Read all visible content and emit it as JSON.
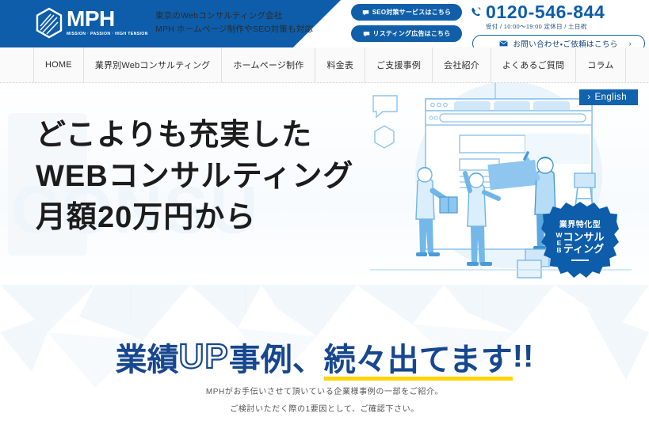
{
  "header": {
    "logo": {
      "name": "MPH",
      "tagline": "MISSION · PASSION · HIGH TENSION"
    },
    "description_line1": "東京のWebコンサルティング会社",
    "description_line2": "MPH ホームページ制作やSEO対策も対応",
    "cta_buttons": [
      {
        "label": "SEO対策サービスはこちら",
        "icon": "speech-bubble-icon"
      },
      {
        "label": "リスティング広告はこちら",
        "icon": "speech-bubble-icon"
      }
    ],
    "phone": {
      "number": "0120-546-844",
      "hours": "受付 / 10:00〜19:00 定休日 / 土日祝",
      "icon": "phone-icon"
    },
    "contact_button": {
      "label": "お問い合わせ・ご依頼はこちら",
      "icon": "mail-icon",
      "chevron": "›"
    }
  },
  "nav": {
    "items": [
      {
        "label": "HOME"
      },
      {
        "label": "業界別Webコンサルティング"
      },
      {
        "label": "ホームページ制作"
      },
      {
        "label": "料金表"
      },
      {
        "label": "ご支援事例"
      },
      {
        "label": "会社紹介"
      },
      {
        "label": "よくあるご質問"
      },
      {
        "label": "コラム"
      }
    ]
  },
  "hero": {
    "watermark": "CONSU",
    "headline": [
      "どこよりも充実した",
      "WEBコンサルティング",
      "月額20万円から"
    ],
    "english_button": {
      "label": "English",
      "chevron": "›"
    },
    "badge": {
      "top": "業界特化型",
      "web": [
        "W",
        "E",
        "B"
      ],
      "kana_line1": "コンサル",
      "kana_line2": "ティング"
    }
  },
  "banner": {
    "heading_part1": "業績",
    "heading_up": "UP",
    "heading_part2": "事例、",
    "heading_highlight": "続々出てます",
    "heading_end": "!!",
    "sub_line1": "MPHがお手伝いさせて頂いている企業様事例の一部をご紹介。",
    "sub_line2": "ご検討いただく際の1要因として、ご確認下さい。"
  },
  "colors": {
    "brand_blue": "#0d5daa",
    "deep_blue": "#17478f",
    "highlight_yellow": "#ffd400",
    "nav_bg": "#fafafa"
  }
}
